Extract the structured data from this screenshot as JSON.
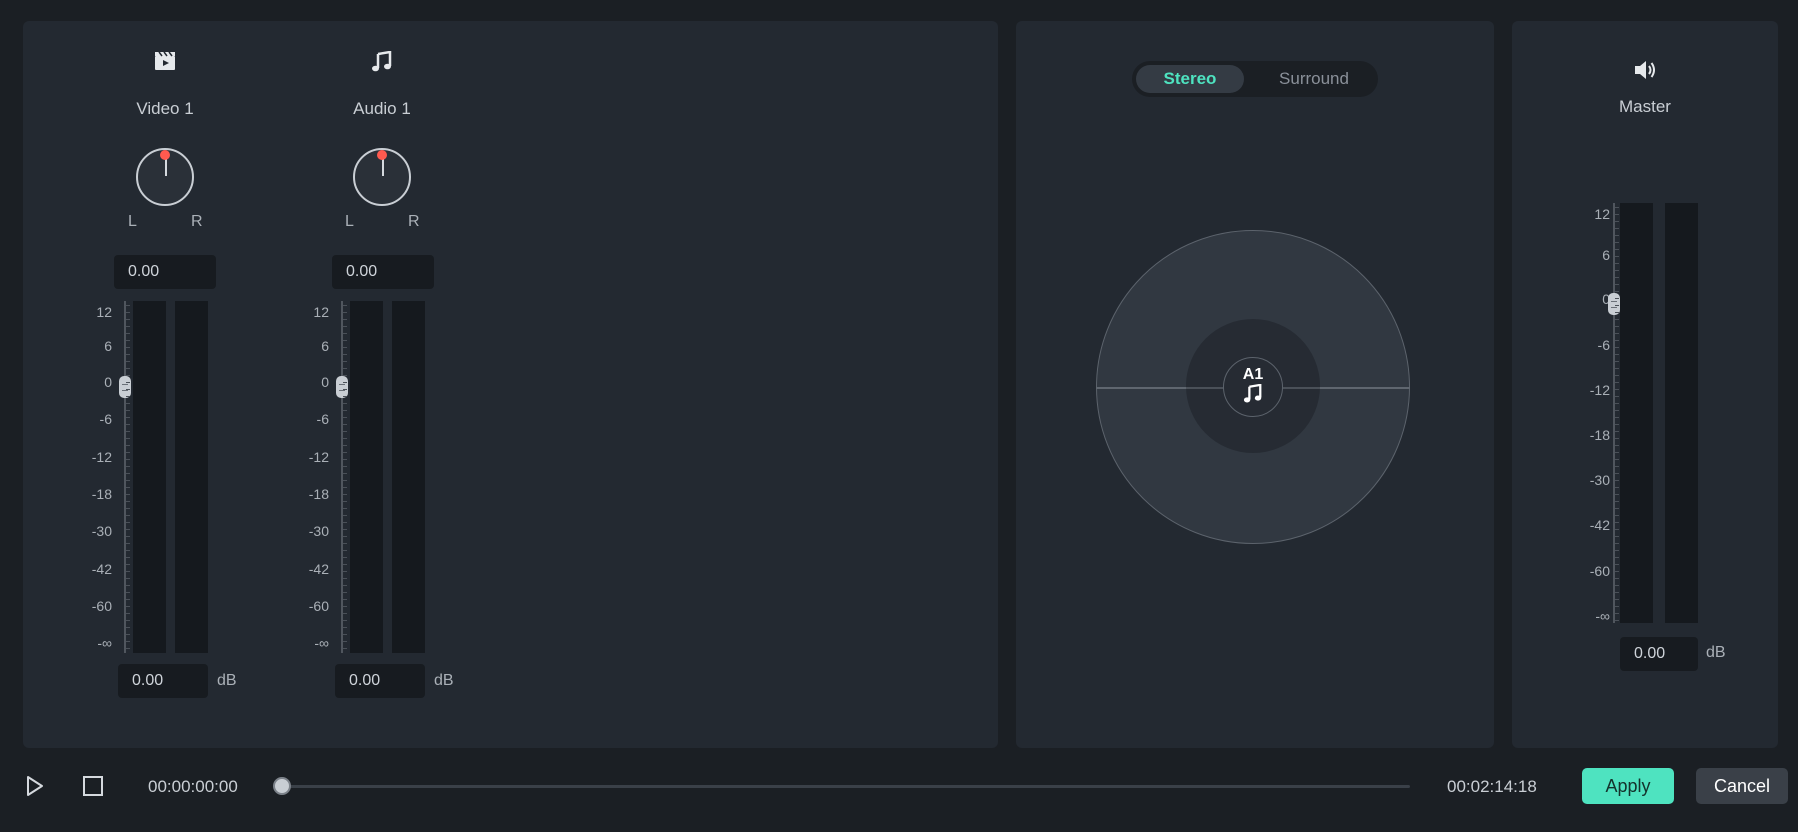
{
  "tracks": [
    {
      "name": "Video  1",
      "icon": "clapperboard-icon",
      "pan_value": "0.00",
      "volume_value": "0.00",
      "unit": "dB",
      "pan_L": "L",
      "pan_R": "R",
      "fader_level_db": 0
    },
    {
      "name": "Audio  1",
      "icon": "music-note-icon",
      "pan_value": "0.00",
      "volume_value": "0.00",
      "unit": "dB",
      "pan_L": "L",
      "pan_R": "R",
      "fader_level_db": 0
    }
  ],
  "scale": [
    "12",
    "6",
    "0",
    "-6",
    "-12",
    "-18",
    "-30",
    "-42",
    "-60",
    "-∞"
  ],
  "pan": {
    "tabs": {
      "stereo": "Stereo",
      "surround": "Surround"
    },
    "active_tab": "stereo",
    "center_label": "A1",
    "center_icon": "music-note-icon"
  },
  "master": {
    "name": "Master",
    "icon": "speaker-icon",
    "volume_value": "0.00",
    "unit": "dB",
    "fader_level_db": 0
  },
  "transport": {
    "current_time": "00:00:00:00",
    "total_time": "00:02:14:18",
    "progress": 0
  },
  "buttons": {
    "apply": "Apply",
    "cancel": "Cancel"
  },
  "colors": {
    "accent": "#4ee3c0",
    "pan_dot": "#ff5a4f",
    "panel": "#232931",
    "background": "#1b1f24"
  }
}
